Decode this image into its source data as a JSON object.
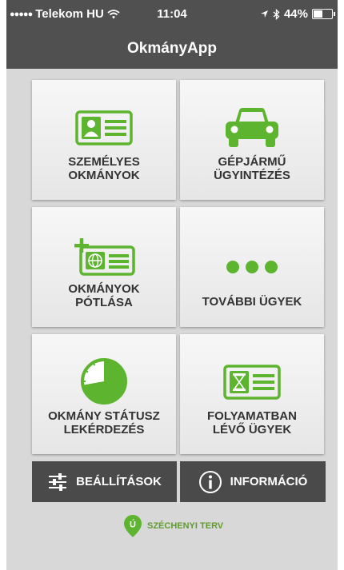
{
  "status_bar": {
    "carrier": "Telekom HU",
    "time": "11:04",
    "battery": "44%"
  },
  "app": {
    "title": "OkmányApp"
  },
  "tiles": [
    {
      "label": "SZEMÉLYES\nOKMÁNYOK",
      "icon": "id-card-icon"
    },
    {
      "label": "GÉPJÁRMŰ\nÜGYINTÉZÉS",
      "icon": "car-icon"
    },
    {
      "label": "OKMÁNYOK\nPÓTLÁSA",
      "icon": "add-document-icon"
    },
    {
      "label": "TOVÁBBI ÜGYEK",
      "icon": "more-icon"
    },
    {
      "label": "OKMÁNY STÁTUSZ\nLEKÉRDEZÉS",
      "icon": "clock-icon"
    },
    {
      "label": "FOLYAMATBAN\nLÉVŐ ÜGYEK",
      "icon": "hourglass-card-icon"
    }
  ],
  "bottom": {
    "settings": "BEÁLLÍTÁSOK",
    "info": "INFORMÁCIÓ"
  },
  "footer": {
    "badge": "Ú",
    "text": "SZÉCHENYI TERV"
  },
  "colors": {
    "accent": "#5db42f",
    "bar": "#505050",
    "button": "#4a4a4a"
  }
}
